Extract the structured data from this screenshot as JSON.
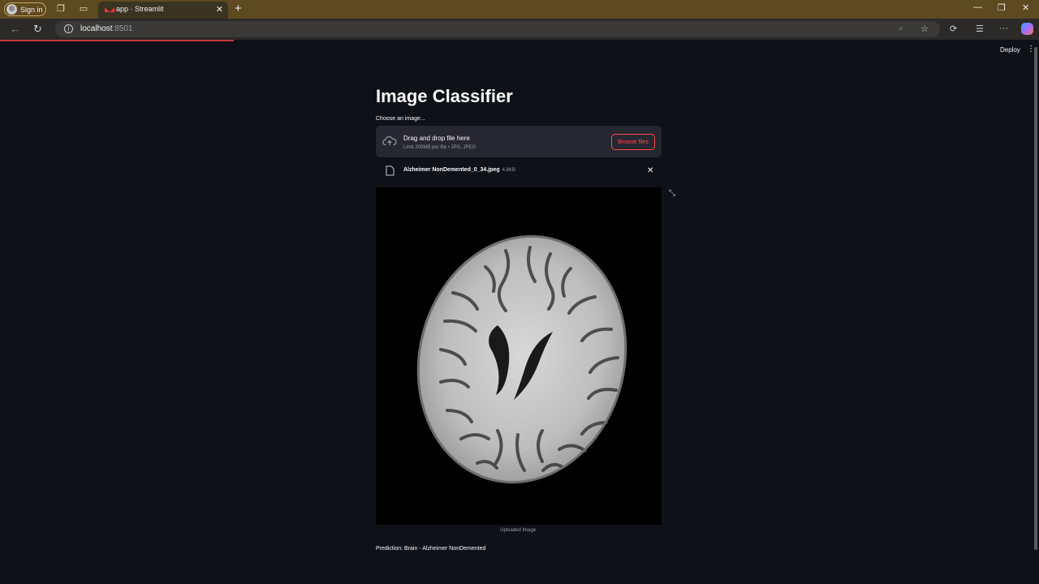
{
  "browser": {
    "signin_label": "Sign in",
    "tab_title": "app · Streamlit",
    "url_host": "localhost",
    "url_port": ":8501"
  },
  "header": {
    "deploy_label": "Deploy"
  },
  "main": {
    "title": "Image Classifier",
    "uploader_label": "Choose an image...",
    "dropzone_title": "Drag and drop file here",
    "dropzone_limit": "Limit 200MB per file • JPG, JPEG",
    "browse_label": "Browse files",
    "file_name": "Alzheimer NonDemented_0_34.jpeg",
    "file_size": "4.8KB",
    "image_caption": "Uploaded Image.",
    "prediction": "Prediction: Brain - Alzheimer NonDemented"
  },
  "colors": {
    "accent": "#ff4b4b",
    "background": "#0e1117",
    "dropzone": "#262730"
  }
}
